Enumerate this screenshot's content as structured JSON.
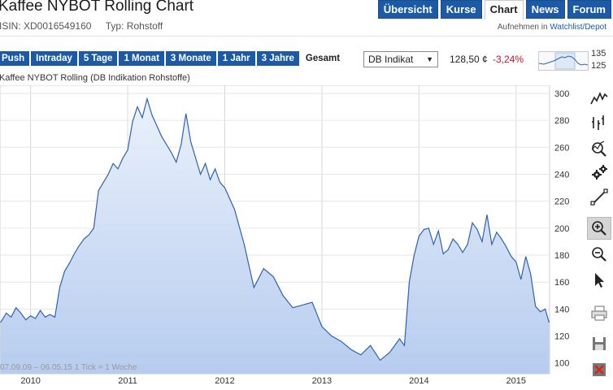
{
  "header": {
    "title": "Kaffee NYBOT Rolling Chart",
    "isin": "ISIN: XD0016549160",
    "type": "Typ: Rohstoff",
    "watch_prefix": "Aufnehmen in",
    "watch_link": "Watchlist/Depot"
  },
  "tabs": [
    {
      "label": "Übersicht",
      "active": false
    },
    {
      "label": "Kurse",
      "active": false
    },
    {
      "label": "Chart",
      "active": true
    },
    {
      "label": "News",
      "active": false
    },
    {
      "label": "Forum",
      "active": false
    }
  ],
  "ranges": [
    {
      "label": "Push",
      "active": false
    },
    {
      "label": "Intraday",
      "active": false
    },
    {
      "label": "5 Tage",
      "active": false
    },
    {
      "label": "1 Monat",
      "active": false
    },
    {
      "label": "3 Monate",
      "active": false
    },
    {
      "label": "1 Jahr",
      "active": false
    },
    {
      "label": "3 Jahre",
      "active": false
    },
    {
      "label": "Gesamt",
      "active": true
    }
  ],
  "indicator": {
    "selected": "DB Indikat"
  },
  "quote": {
    "price": "128,50 ¢",
    "change": "-3,24%"
  },
  "mini_chart": {
    "labels": [
      "135",
      "125"
    ]
  },
  "chart_caption": "Kaffee NYBOT Rolling (DB Indikation Rohstoffe)",
  "chart_footer": "07.09.09 – 06.05.15     1 Tick = 1 Woche",
  "colors": {
    "accent": "#1c5aa6",
    "line": "#2e62b0",
    "area_top": "#eaf1fb",
    "area_bottom": "#b7ccef",
    "negative": "#c8102e"
  },
  "toolbar": [
    {
      "name": "line-chart-icon",
      "selected": false
    },
    {
      "name": "ohlc-chart-icon",
      "selected": false
    },
    {
      "name": "indicator-magnifier-icon",
      "selected": false
    },
    {
      "name": "settings-gears-icon",
      "selected": false
    },
    {
      "name": "draw-line-icon",
      "selected": false
    },
    {
      "name": "zoom-in-icon",
      "selected": true
    },
    {
      "name": "zoom-out-icon",
      "selected": false
    },
    {
      "name": "cursor-pointer-icon",
      "selected": false
    },
    {
      "name": "print-icon",
      "selected": false
    },
    {
      "name": "save-icon",
      "selected": false
    },
    {
      "name": "delete-icon",
      "selected": false
    }
  ],
  "chart_data": {
    "type": "area",
    "title": "Kaffee NYBOT Rolling (DB Indikation Rohstoffe)",
    "xlabel": "",
    "ylabel": "",
    "x_ticks": [
      "2010",
      "2011",
      "2012",
      "2013",
      "2014",
      "2015"
    ],
    "y_ticks": [
      100,
      120,
      140,
      160,
      180,
      200,
      220,
      240,
      260,
      280,
      300
    ],
    "ylim": [
      92,
      306
    ],
    "xlim": [
      2009.685,
      2015.345
    ],
    "grid": true,
    "y_axis_side": "right",
    "x": [
      2009.69,
      2009.75,
      2009.8,
      2009.85,
      2009.9,
      2009.95,
      2010.0,
      2010.05,
      2010.1,
      2010.15,
      2010.2,
      2010.25,
      2010.3,
      2010.35,
      2010.4,
      2010.45,
      2010.5,
      2010.55,
      2010.6,
      2010.65,
      2010.7,
      2010.75,
      2010.8,
      2010.85,
      2010.9,
      2010.95,
      2011.0,
      2011.05,
      2011.1,
      2011.15,
      2011.2,
      2011.25,
      2011.3,
      2011.35,
      2011.4,
      2011.45,
      2011.5,
      2011.55,
      2011.6,
      2011.65,
      2011.7,
      2011.75,
      2011.8,
      2011.85,
      2011.9,
      2011.95,
      2012.0,
      2012.1,
      2012.2,
      2012.3,
      2012.4,
      2012.5,
      2012.6,
      2012.7,
      2012.8,
      2012.9,
      2013.0,
      2013.1,
      2013.2,
      2013.3,
      2013.4,
      2013.5,
      2013.6,
      2013.7,
      2013.8,
      2013.85,
      2013.9,
      2013.95,
      2014.0,
      2014.05,
      2014.1,
      2014.15,
      2014.2,
      2014.25,
      2014.3,
      2014.35,
      2014.4,
      2014.45,
      2014.5,
      2014.55,
      2014.6,
      2014.65,
      2014.7,
      2014.75,
      2014.8,
      2014.85,
      2014.9,
      2014.95,
      2015.0,
      2015.05,
      2015.1,
      2015.15,
      2015.2,
      2015.25,
      2015.3,
      2015.34
    ],
    "y": [
      130,
      137,
      134,
      141,
      137,
      132,
      135,
      133,
      139,
      134,
      136,
      134,
      156,
      168,
      174,
      181,
      187,
      192,
      195,
      200,
      228,
      234,
      240,
      248,
      244,
      252,
      258,
      279,
      290,
      282,
      296,
      284,
      276,
      268,
      262,
      256,
      249,
      262,
      285,
      264,
      252,
      240,
      248,
      236,
      244,
      234,
      230,
      214,
      188,
      156,
      170,
      164,
      150,
      141,
      143,
      145,
      127,
      120,
      116,
      110,
      106,
      113,
      102,
      108,
      118,
      113,
      160,
      180,
      194,
      199,
      200,
      188,
      198,
      181,
      184,
      192,
      188,
      182,
      188,
      204,
      199,
      190,
      210,
      188,
      197,
      192,
      186,
      179,
      175,
      162,
      179,
      166,
      142,
      138,
      140,
      130
    ]
  }
}
